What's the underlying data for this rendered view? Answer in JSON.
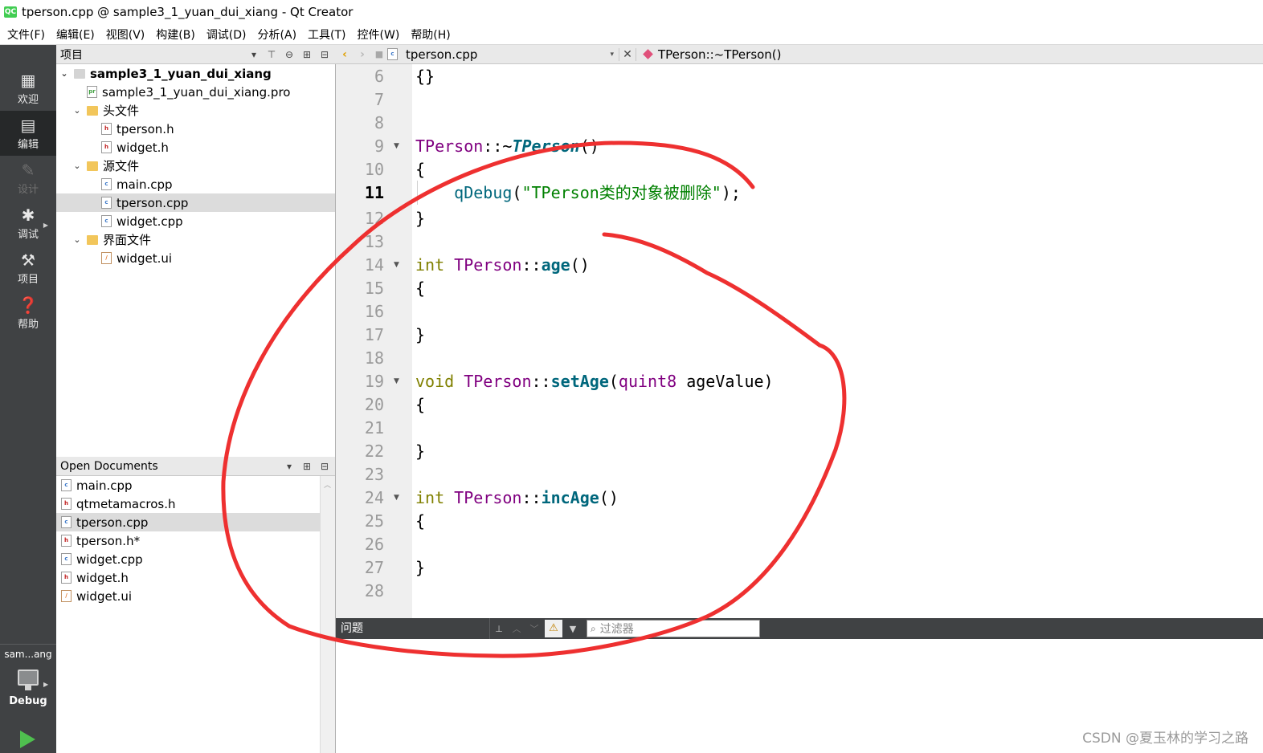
{
  "window": {
    "title": "tperson.cpp @ sample3_1_yuan_dui_xiang - Qt Creator",
    "app_icon": "QC"
  },
  "menu": [
    "文件(F)",
    "编辑(E)",
    "视图(V)",
    "构建(B)",
    "调试(D)",
    "分析(A)",
    "工具(T)",
    "控件(W)",
    "帮助(H)"
  ],
  "modes": [
    {
      "label": "欢迎",
      "icon": "grid-icon"
    },
    {
      "label": "编辑",
      "icon": "edit-icon",
      "active": true
    },
    {
      "label": "设计",
      "icon": "pen-icon",
      "disabled": true
    },
    {
      "label": "调试",
      "icon": "bug-icon"
    },
    {
      "label": "项目",
      "icon": "wrench-icon"
    },
    {
      "label": "帮助",
      "icon": "help-icon"
    }
  ],
  "kit": {
    "name": "sam...ang",
    "config": "Debug"
  },
  "project_panel": {
    "title": "项目",
    "tree": [
      {
        "label": "sample3_1_yuan_dui_xiang",
        "depth": 0,
        "kind": "project"
      },
      {
        "label": "sample3_1_yuan_dui_xiang.pro",
        "depth": 1,
        "kind": "pro"
      },
      {
        "label": "头文件",
        "depth": 1,
        "kind": "folder"
      },
      {
        "label": "tperson.h",
        "depth": 2,
        "kind": "h"
      },
      {
        "label": "widget.h",
        "depth": 2,
        "kind": "h"
      },
      {
        "label": "源文件",
        "depth": 1,
        "kind": "folder"
      },
      {
        "label": "main.cpp",
        "depth": 2,
        "kind": "cpp"
      },
      {
        "label": "tperson.cpp",
        "depth": 2,
        "kind": "cpp",
        "selected": true
      },
      {
        "label": "widget.cpp",
        "depth": 2,
        "kind": "cpp"
      },
      {
        "label": "界面文件",
        "depth": 1,
        "kind": "folder"
      },
      {
        "label": "widget.ui",
        "depth": 2,
        "kind": "ui"
      }
    ]
  },
  "open_documents": {
    "title": "Open Documents",
    "items": [
      {
        "label": "main.cpp",
        "kind": "cpp"
      },
      {
        "label": "qtmetamacros.h",
        "kind": "h"
      },
      {
        "label": "tperson.cpp",
        "kind": "cpp",
        "selected": true
      },
      {
        "label": "tperson.h*",
        "kind": "h"
      },
      {
        "label": "widget.cpp",
        "kind": "cpp"
      },
      {
        "label": "widget.h",
        "kind": "h"
      },
      {
        "label": "widget.ui",
        "kind": "ui"
      }
    ]
  },
  "editor": {
    "file": "tperson.cpp",
    "symbol": "TPerson::~TPerson()",
    "current_line": "11",
    "line_numbers": [
      "6",
      "7",
      "8",
      "9",
      "10",
      "11",
      "12",
      "13",
      "14",
      "15",
      "16",
      "17",
      "18",
      "19",
      "20",
      "21",
      "22",
      "23",
      "24",
      "25",
      "26",
      "27",
      "28"
    ],
    "foldable_lines": [
      "9",
      "14",
      "19",
      "24"
    ],
    "code": {
      "l6": "{}",
      "l9_class": "TPerson",
      "l9_scope": "::~",
      "l9_fn": "TPerson",
      "l9_parens": "()",
      "l10": "{",
      "l11_fn": "qDebug",
      "l11_open": "(",
      "l11_str": "\"TPerson类的对象被删除\"",
      "l11_close": ");",
      "l12": "}",
      "l14_kw": "int",
      "l14_class": "TPerson",
      "l14_scope": "::",
      "l14_fn": "age",
      "l14_parens": "()",
      "l15": "{",
      "l17": "}",
      "l19_kw": "void",
      "l19_class": "TPerson",
      "l19_scope": "::",
      "l19_fn": "setAge",
      "l19_open": "(",
      "l19_type": "quint8",
      "l19_param": " ageValue)",
      "l20": "{",
      "l22": "}",
      "l24_kw": "int",
      "l24_class": "TPerson",
      "l24_scope": "::",
      "l24_fn": "incAge",
      "l24_parens": "()",
      "l25": "{",
      "l27": "}"
    }
  },
  "issues": {
    "title": "问题",
    "filter_placeholder": "过滤器"
  },
  "watermark": "CSDN @夏玉林的学习之路",
  "colors": {
    "annotation": "#ee3030",
    "mode_bar": "#404244",
    "keyword": "#808000",
    "type": "#800080",
    "function": "#00677c",
    "string": "#008000"
  }
}
